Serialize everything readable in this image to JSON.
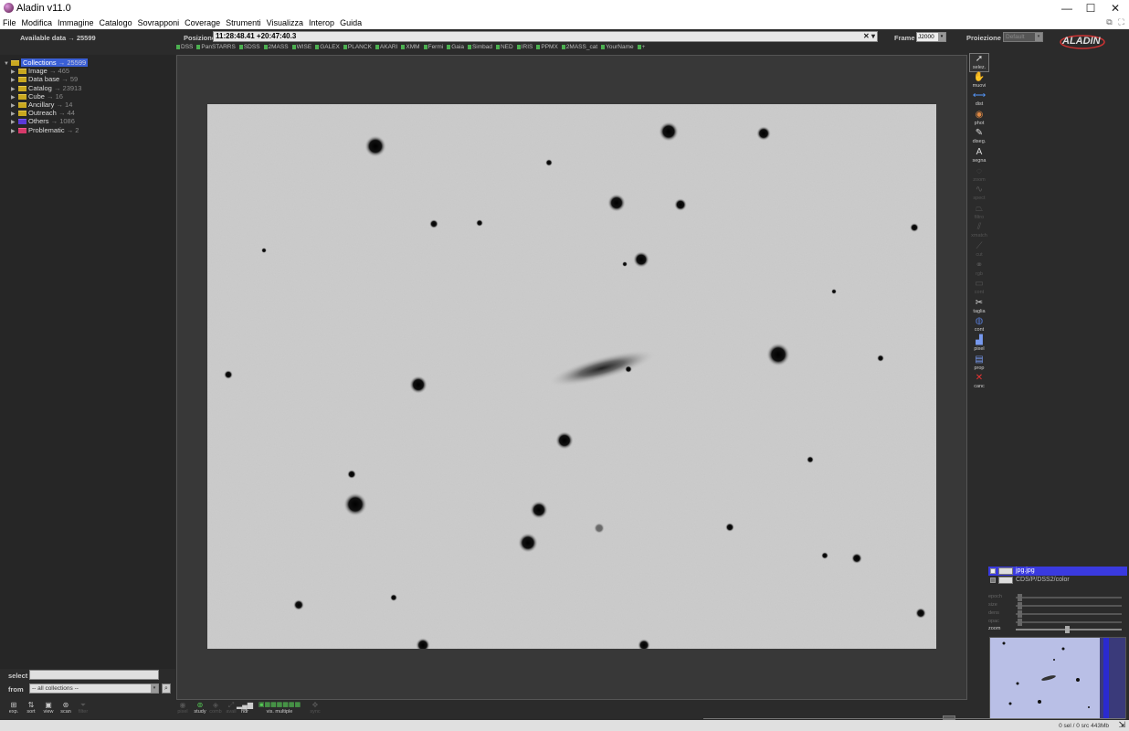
{
  "window": {
    "title": "Aladin v11.0",
    "minimize": "—",
    "maximize": "☐",
    "close": "✕"
  },
  "menu": [
    "File",
    "Modifica",
    "Immagine",
    "Catalogo",
    "Sovrapponi",
    "Coverage",
    "Strumenti",
    "Visualizza",
    "Interop",
    "Guida"
  ],
  "topbar": {
    "available_label": "Available data → 25599",
    "position_label": "Posizione",
    "position_value": "11:28:48.41 +20:47:40.3",
    "frame_label": "Frame",
    "frame_value": "J2000",
    "projection_label": "Proiezione",
    "projection_value": "Default",
    "logo_text": "ALADIN"
  },
  "surveys": [
    "DSS",
    "PanSTARRS",
    "SDSS",
    "2MASS",
    "WISE",
    "GALEX",
    "PLANCK",
    "AKARI",
    "XMM",
    "Fermi",
    "Gaia",
    "Simbad",
    "NED",
    "IRIS",
    "PPMX",
    "2MASS_cat",
    "YourName"
  ],
  "tree": {
    "root": {
      "label": "Collections",
      "count": "→ 25599"
    },
    "items": [
      {
        "label": "Image",
        "count": "→ 465",
        "color": "#c9a820"
      },
      {
        "label": "Data base",
        "count": "→ 59",
        "color": "#c9a820"
      },
      {
        "label": "Catalog",
        "count": "→ 23913",
        "color": "#c9a820"
      },
      {
        "label": "Cube",
        "count": "→ 16",
        "color": "#c9a820"
      },
      {
        "label": "Ancillary",
        "count": "→ 14",
        "color": "#c9a820"
      },
      {
        "label": "Outreach",
        "count": "→ 44",
        "color": "#c9a820"
      },
      {
        "label": "Others",
        "count": "→ 1086",
        "color": "#5a3ad8"
      },
      {
        "label": "Problematic",
        "count": "→ 2",
        "color": "#d63a6a"
      }
    ]
  },
  "filter": {
    "select_label": "select",
    "from_label": "from",
    "from_value": "-- all collections --"
  },
  "left_tools": [
    "exp.",
    "sort",
    "view",
    "scan",
    "filter"
  ],
  "bottom_tools": [
    "pixel",
    "study",
    "comb",
    "avail",
    "hdr",
    "vis. multiple",
    "sync"
  ],
  "right_tools": [
    "selez.",
    "muovi",
    "dist",
    "phot",
    "diseg.",
    "segna",
    "zoom",
    "spect",
    "filtro",
    "xmatch",
    "cut",
    "rgb",
    "cont",
    "taglia",
    "cont",
    "pixel",
    "prop",
    "canc"
  ],
  "layers": [
    {
      "label": "jpg.jpg",
      "active": true
    },
    {
      "label": "CDS/P/DSS2/color",
      "active": false
    }
  ],
  "sliders": [
    "epoch",
    "size",
    "dens",
    "opac",
    "zoom"
  ],
  "status": {
    "text": "0 sel / 0 src  443Mb"
  },
  "colors": {
    "accent": "#3a5fd6",
    "survey_green": "#4caf50",
    "image_gray": "#cfcfcf"
  }
}
